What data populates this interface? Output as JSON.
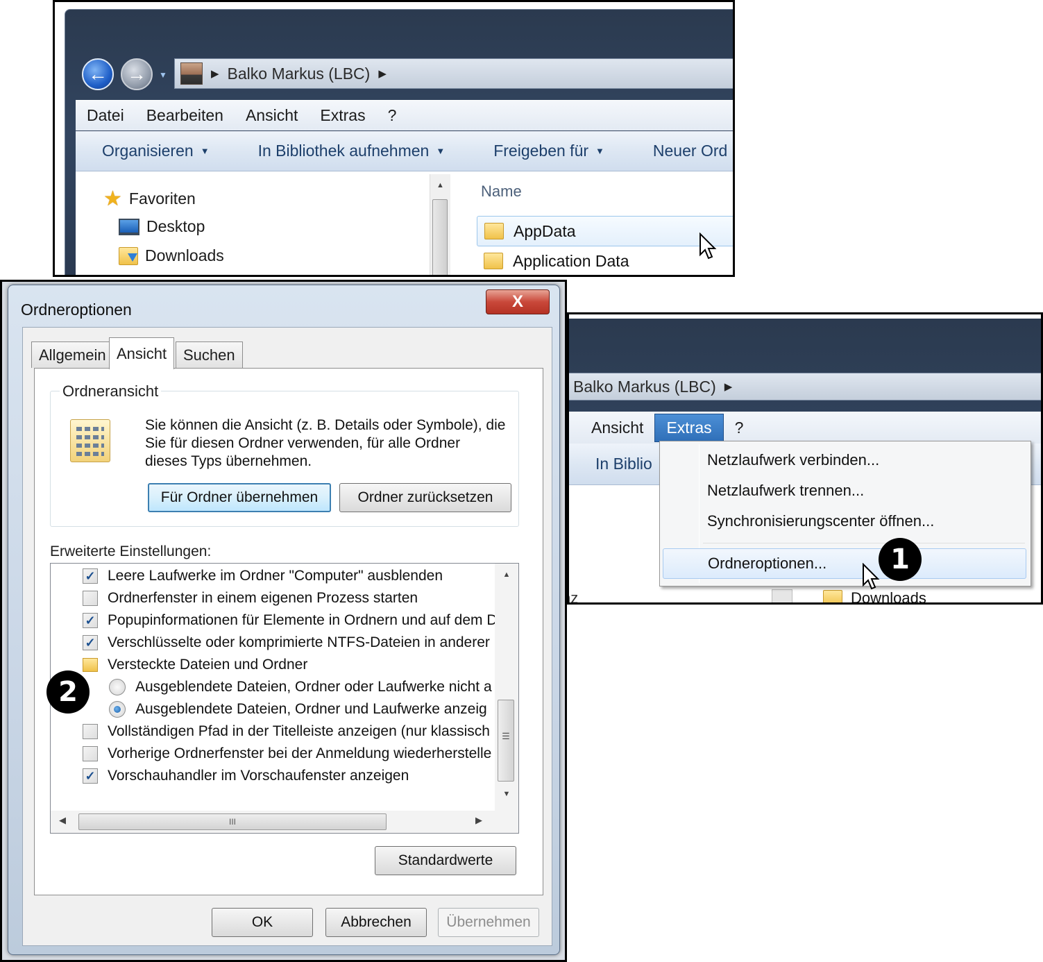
{
  "explorer": {
    "address_user": "Balko Markus (LBC)",
    "menu": [
      "Datei",
      "Bearbeiten",
      "Ansicht",
      "Extras",
      "?"
    ],
    "commands": [
      "Organisieren",
      "In Bibliothek aufnehmen",
      "Freigeben für",
      "Neuer Ord"
    ],
    "nav": {
      "favorites": "Favoriten",
      "desktop": "Desktop",
      "downloads": "Downloads"
    },
    "column_name": "Name",
    "files": [
      "AppData",
      "Application Data"
    ]
  },
  "dialog": {
    "title": "Ordneroptionen",
    "close": "X",
    "tabs": [
      "Allgemein",
      "Ansicht",
      "Suchen"
    ],
    "active_tab": "Ansicht",
    "folder_view": {
      "label": "Ordneransicht",
      "description": "Sie können die Ansicht (z. B. Details oder Symbole), die Sie für diesen Ordner verwenden, für alle Ordner dieses Typs übernehmen.",
      "apply_button": "Für Ordner übernehmen",
      "reset_button": "Ordner zurücksetzen"
    },
    "advanced_label": "Erweiterte Einstellungen:",
    "settings": [
      {
        "kind": "checkbox",
        "checked": true,
        "label": "Leere Laufwerke im Ordner \"Computer\" ausblenden"
      },
      {
        "kind": "checkbox",
        "checked": false,
        "label": "Ordnerfenster in einem eigenen Prozess starten"
      },
      {
        "kind": "checkbox",
        "checked": true,
        "label": "Popupinformationen für Elemente in Ordnern und auf dem D"
      },
      {
        "kind": "checkbox",
        "checked": true,
        "label": "Verschlüsselte oder komprimierte NTFS-Dateien in anderer"
      },
      {
        "kind": "folder",
        "label": "Versteckte Dateien und Ordner"
      },
      {
        "kind": "radio",
        "checked": false,
        "label": "Ausgeblendete Dateien, Ordner oder Laufwerke nicht a"
      },
      {
        "kind": "radio",
        "checked": true,
        "label": "Ausgeblendete Dateien, Ordner und Laufwerke anzeig"
      },
      {
        "kind": "checkbox",
        "checked": false,
        "label": "Vollständigen Pfad in der Titelleiste anzeigen (nur klassisch"
      },
      {
        "kind": "checkbox",
        "checked": false,
        "label": "Vorherige Ordnerfenster bei der Anmeldung wiederherstelle"
      },
      {
        "kind": "checkbox",
        "checked": true,
        "label": "Vorschauhandler im Vorschaufenster anzeigen"
      }
    ],
    "scroll_grip": "III",
    "vscroll_grip": "☰",
    "defaults_button": "Standardwerte",
    "ok_button": "OK",
    "cancel_button": "Abbrechen",
    "apply_button": "Übernehmen"
  },
  "extras_panel": {
    "address_user": "Balko Markus (LBC)",
    "menu": [
      "Ansicht",
      "Extras",
      "?"
    ],
    "open_menu": "Extras",
    "command_partial": "In Biblio",
    "pane_partial": [
      "nz",
      "Downloads"
    ],
    "dropdown": [
      "Netzlaufwerk verbinden...",
      "Netzlaufwerk trennen...",
      "Synchronisierungscenter öffnen...",
      "Ordneroptionen..."
    ]
  },
  "badges": [
    "1",
    "2"
  ],
  "colors": {
    "accent": "#2f6fb8",
    "badge": "#000000",
    "close": "#c9483a"
  }
}
